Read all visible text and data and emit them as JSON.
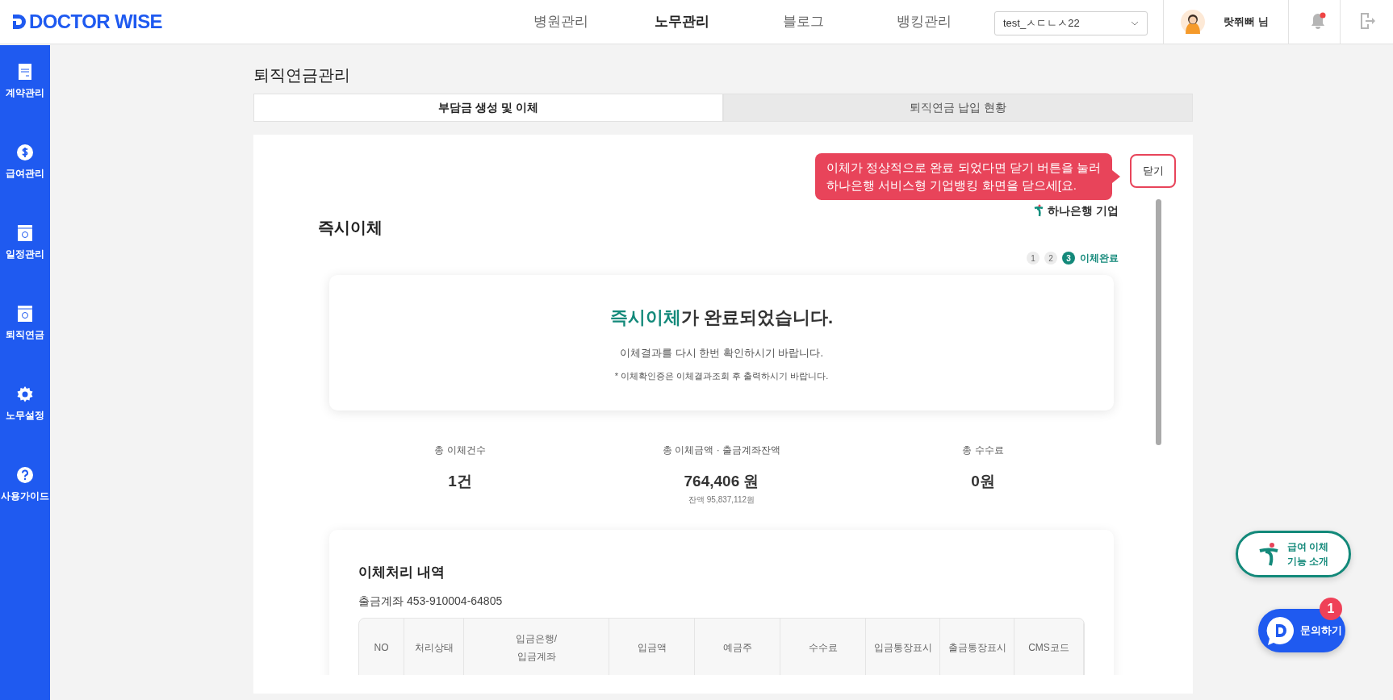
{
  "header": {
    "logo": "DOCTOR WISE",
    "nav": [
      {
        "label": "병원관리",
        "selected": false
      },
      {
        "label": "노무관리",
        "selected": true
      },
      {
        "label": "블로그",
        "selected": false
      },
      {
        "label": "뱅킹관리",
        "selected": false
      }
    ],
    "account_select": "test_ㅅㄷㄴㅅ22",
    "user": "랏쮜뻐 님",
    "notification": true
  },
  "sidebar": {
    "items": [
      {
        "label": "계약관리",
        "kind": "document"
      },
      {
        "label": "급여관리",
        "kind": "dollar"
      },
      {
        "label": "일정관리",
        "kind": "calendar"
      },
      {
        "label": "퇴직연금",
        "kind": "calendar"
      },
      {
        "label": "노무설정",
        "kind": "gear"
      },
      {
        "label": "사용가이드",
        "kind": "help"
      }
    ]
  },
  "page_title": "퇴직연금관리",
  "tabs": [
    {
      "label": "부담금 생성 및 이체",
      "selected": true
    },
    {
      "label": "퇴직연금 납입 현황",
      "selected": false
    }
  ],
  "tooltip": {
    "lines": [
      "이체가 정상적으로 완료 되었다면 닫기 버튼을 눌러",
      "하나은행 서비스형 기업뱅킹 화면을 닫으세[요."
    ]
  },
  "close_button": "닫기",
  "bank_label": "하나은행 기업",
  "section_title": "즉시이체",
  "steps": [
    {
      "label": "1",
      "selected": false
    },
    {
      "label": "2",
      "selected": false
    },
    {
      "label": "3",
      "selected": true,
      "text": "이체완료"
    }
  ],
  "result": {
    "headline": "**즉시이체**가 완료되었습니다.",
    "message": "이체결과를 다시 한번 확인하시기 바랍니다.",
    "note": "* 이체확인증은 이체결과조회 후 출력하시기 바랍니다."
  },
  "stats": [
    {
      "label": "총 이체건수",
      "value": "1건"
    },
    {
      "label": "총 이체금액 · 출금계좌잔액",
      "value": "764,406 원",
      "sub": "잔액 95,837,112원"
    },
    {
      "label": "총 수수료",
      "value": "0원"
    }
  ],
  "history": {
    "title": "이체처리 내역",
    "account": "출금계좌 453-910004-64805",
    "columns": [
      "NO",
      "처리상태",
      "입금은행/\n입금계좌",
      "입금액",
      "예금주",
      "수수료",
      "입금통장표시",
      "출금통장표시",
      "CMS코드"
    ]
  },
  "floating": {
    "intro_button": [
      "급여 이체",
      "기능 소개"
    ],
    "inquiry_button": "문의하기",
    "inquiry_badge": "1"
  }
}
